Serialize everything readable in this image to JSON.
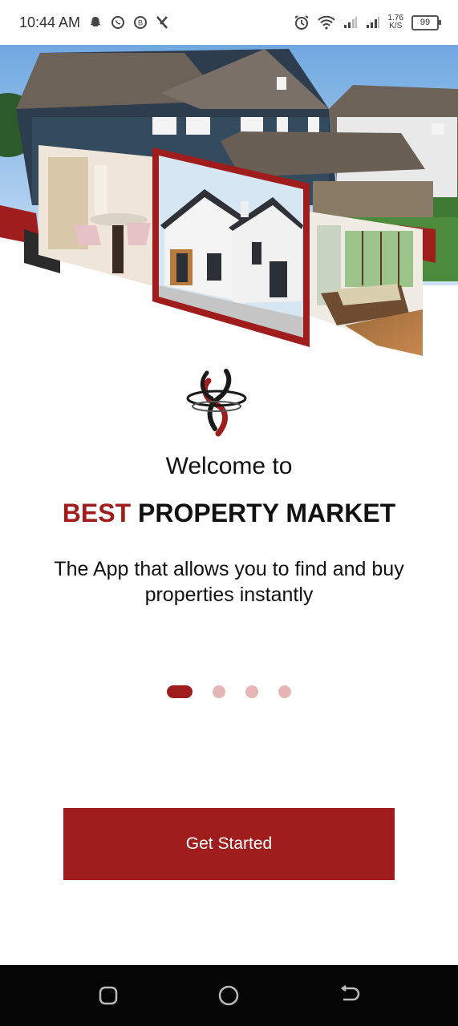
{
  "status_bar": {
    "time": "10:44 AM",
    "net_speed_value": "1.76",
    "net_speed_unit": "K/S",
    "battery": "99",
    "icons": [
      "snapchat-icon",
      "whatsapp-icon",
      "business-chat-icon",
      "x-app-icon",
      "alarm-icon",
      "wifi-icon",
      "signal-icon",
      "signal-icon-2",
      "battery-icon"
    ]
  },
  "hero": {
    "image": "house-collage",
    "description_icons": [
      "house-exterior-photo",
      "dining-room-photo",
      "modern-house-photo",
      "living-room-photo"
    ]
  },
  "onboarding": {
    "welcome": "Welcome to",
    "brand_accent": "BEST",
    "brand_rest": " PROPERTY MARKET",
    "tagline": "The App that allows you to find and buy properties instantly",
    "pager": {
      "total": 4,
      "current": 1
    },
    "cta_label": "Get Started"
  },
  "colors": {
    "accent": "#a01d1d",
    "dot_inactive": "#e6b6b6",
    "nav_bar": "#050505"
  },
  "nav_bar": {
    "buttons": [
      "recent-apps-icon",
      "home-icon",
      "back-icon"
    ]
  }
}
